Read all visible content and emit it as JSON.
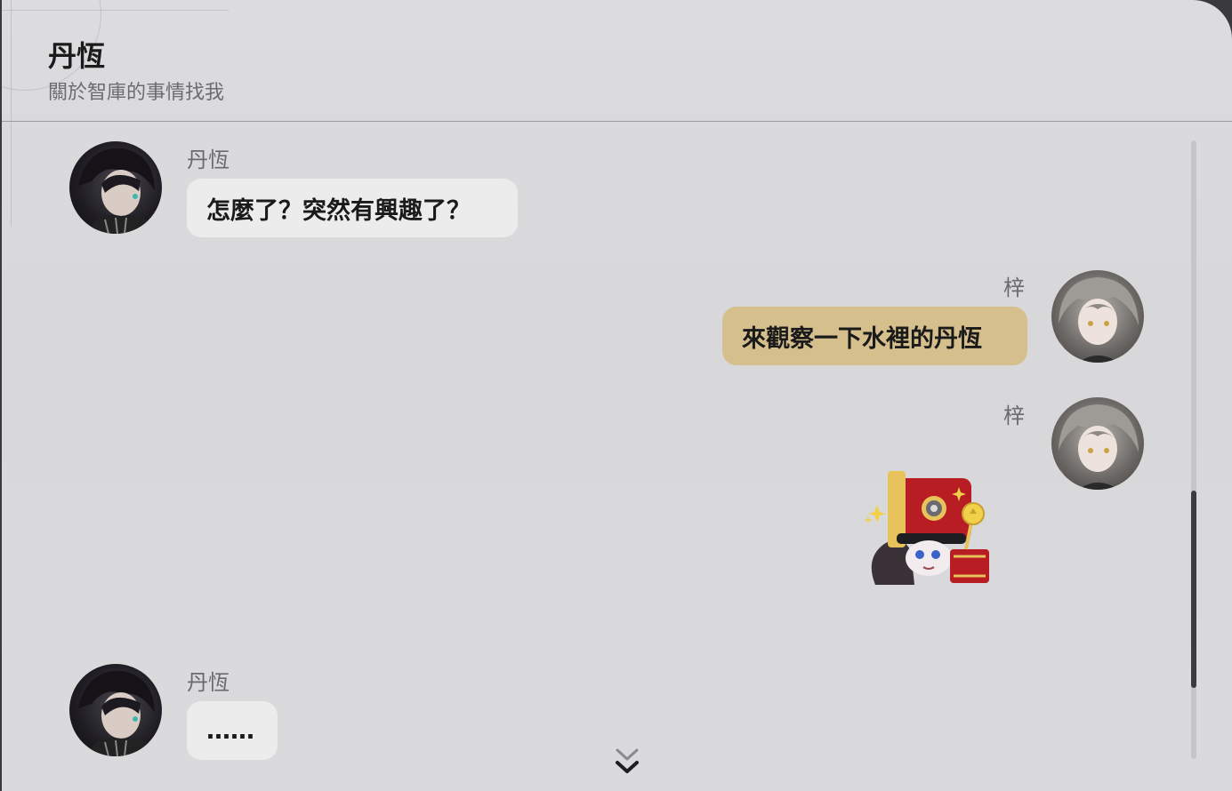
{
  "header": {
    "title": "丹恆",
    "subtitle": "關於智庫的事情找我"
  },
  "messages": [
    {
      "sender": "丹恆",
      "text": "怎麼了？突然有興趣了？",
      "side": "left",
      "avatar": "danheng-avatar"
    },
    {
      "sender": "梓",
      "text": "來觀察一下水裡的丹恆",
      "side": "right",
      "avatar": "trailblazer-avatar"
    },
    {
      "sender": "梓",
      "sticker": "pom-pom-thumbs-up-sticker",
      "side": "right",
      "avatar": "trailblazer-avatar"
    },
    {
      "sender": "丹恆",
      "text": "……",
      "side": "left",
      "avatar": "danheng-avatar"
    }
  ],
  "colors": {
    "incoming_bubble": "#ececed",
    "outgoing_bubble": "#d5bf8d",
    "background": "#dadadc"
  },
  "controls": {
    "scroll_down_icon": "double-chevron-down-icon"
  }
}
